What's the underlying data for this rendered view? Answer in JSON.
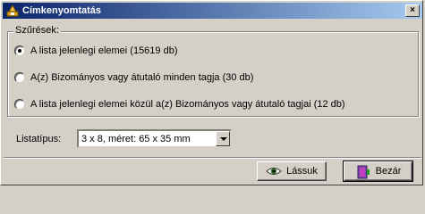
{
  "window": {
    "title": "Címkenyomtatás",
    "close_glyph": "×"
  },
  "filter_group": {
    "legend": "Szűrések:",
    "options": [
      {
        "label": "A lista jelenlegi elemei (15619 db)",
        "checked": true
      },
      {
        "label": "A(z) Bizományos vagy átutaló minden tagja (30 db)",
        "checked": false
      },
      {
        "label": "A lista jelenlegi elemei közül a(z) Bizományos vagy átutaló tagjai (12 db)",
        "checked": false
      }
    ]
  },
  "list_type": {
    "label": "Listatípus:",
    "selected": "3 x 8, méret: 65 x 35 mm"
  },
  "buttons": {
    "preview_label": "Lássuk",
    "close_label": "Bezár"
  },
  "icons": {
    "app": "app-icon",
    "preview": "eye-icon",
    "close": "door-exit-icon"
  }
}
